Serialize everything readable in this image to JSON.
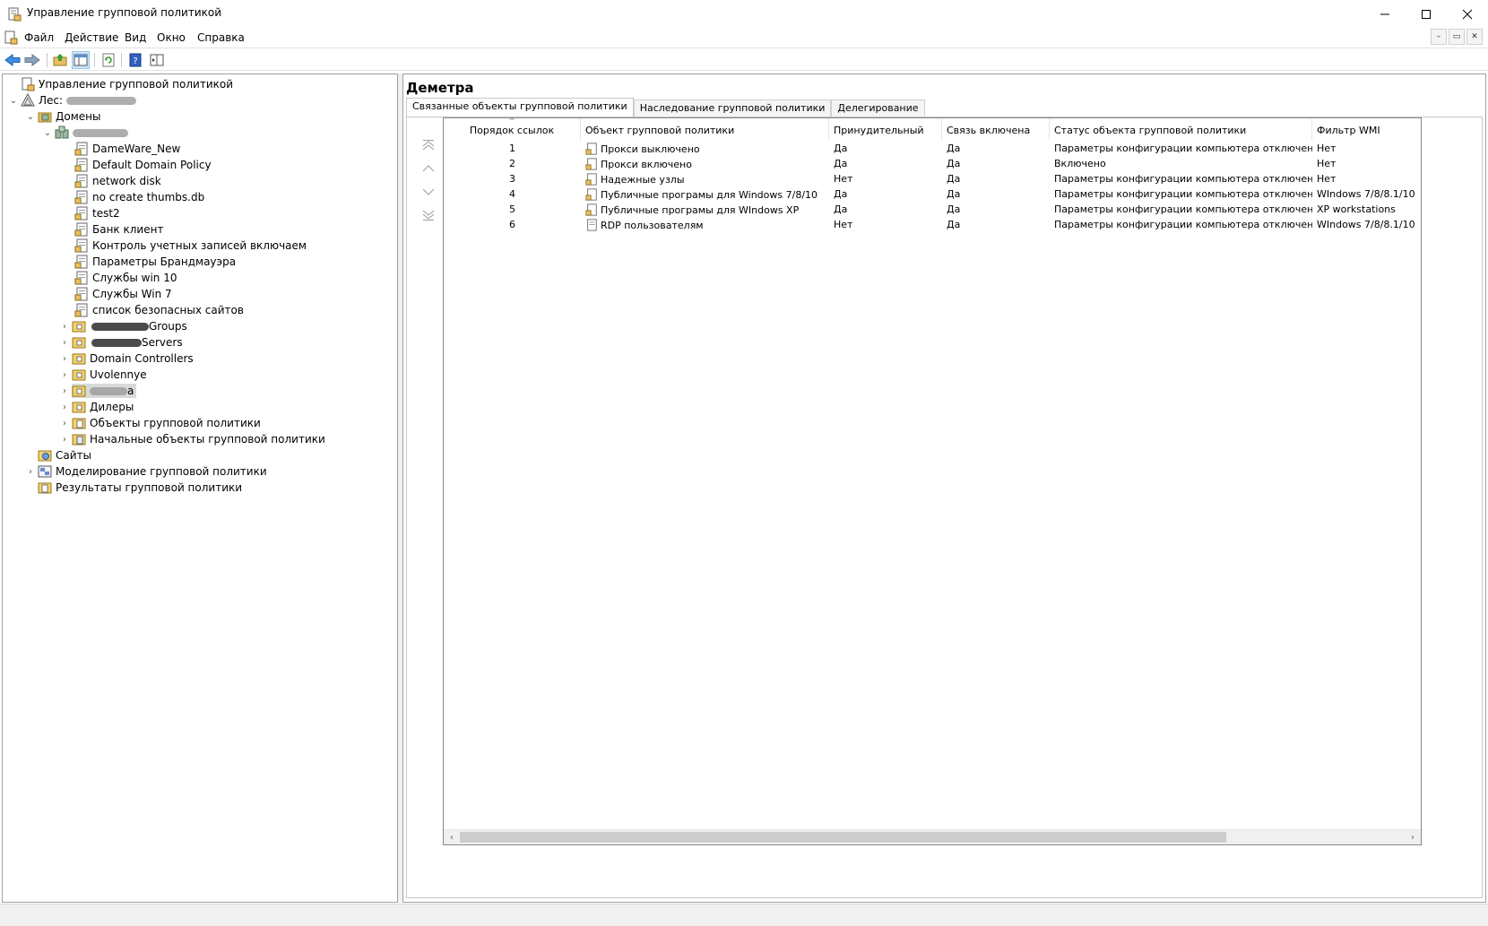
{
  "window": {
    "title": "Управление групповой политикой",
    "buttons": [
      "minimize",
      "maximize",
      "close"
    ]
  },
  "menu": {
    "items": [
      {
        "label": "Файл"
      },
      {
        "label": "Действие"
      },
      {
        "label": "Вид"
      },
      {
        "label": "Окно"
      },
      {
        "label": "Справка"
      }
    ]
  },
  "toolbar": {
    "buttons": [
      "back-icon",
      "forward-icon",
      "up-folder-icon",
      "show-hide-tree-icon",
      "refresh-icon",
      "help-icon",
      "properties-icon"
    ]
  },
  "tree": {
    "root": "Управление групповой политикой",
    "forest_label": "Лес:",
    "domains": "Домены",
    "gpo_links": [
      "DameWare_New",
      "Default Domain Policy",
      "network disk",
      "no create thumbs.db",
      "test2",
      "Банк клиент",
      "Контроль учетных записей включаем",
      "Параметры Брандмауэра",
      "Службы win 10",
      "Службы Win 7",
      "список безопасных сайтов"
    ],
    "ous": [
      {
        "label": "Groups"
      },
      {
        "label": "Servers"
      },
      {
        "label": "Domain Controllers"
      },
      {
        "label": "Uvolennye"
      },
      {
        "label": "а"
      },
      {
        "label": "Дилеры"
      },
      {
        "label": "Объекты групповой политики"
      },
      {
        "label": "Начальные объекты групповой политики"
      }
    ],
    "sites": "Сайты",
    "modeling": "Моделирование групповой политики",
    "results": "Результаты групповой политики"
  },
  "right": {
    "title": "Деметра",
    "tabs": [
      "Связанные объекты групповой политики",
      "Наследование групповой политики",
      "Делегирование"
    ],
    "columns": [
      "Порядок ссылок",
      "Объект групповой политики",
      "Принудительный",
      "Связь включена",
      "Статус объекта групповой политики",
      "Фильтр WMI"
    ],
    "rows": [
      {
        "order": "1",
        "gpo": "Прокси выключено",
        "enforced": "Да",
        "link": "Да",
        "status": "Параметры конфигурации компьютера отключены",
        "wmi": "Нет"
      },
      {
        "order": "2",
        "gpo": "Прокси включено",
        "enforced": "Да",
        "link": "Да",
        "status": "Включено",
        "wmi": "Нет"
      },
      {
        "order": "3",
        "gpo": "Надежные узлы",
        "enforced": "Нет",
        "link": "Да",
        "status": "Параметры конфигурации компьютера отключены",
        "wmi": "Нет"
      },
      {
        "order": "4",
        "gpo": "Публичные програмы для Windows 7/8/10",
        "enforced": "Да",
        "link": "Да",
        "status": "Параметры конфигурации компьютера отключены",
        "wmi": "WIndows 7/8/8.1/10"
      },
      {
        "order": "5",
        "gpo": "Публичные програмы для WIndows XP",
        "enforced": "Да",
        "link": "Да",
        "status": "Параметры конфигурации компьютера отключены",
        "wmi": "XP workstations"
      },
      {
        "order": "6",
        "gpo": "RDP пользователям",
        "enforced": "Нет",
        "link": "Да",
        "status": "Параметры конфигурации компьютера отключены",
        "wmi": "WIndows 7/8/8.1/10"
      }
    ]
  }
}
